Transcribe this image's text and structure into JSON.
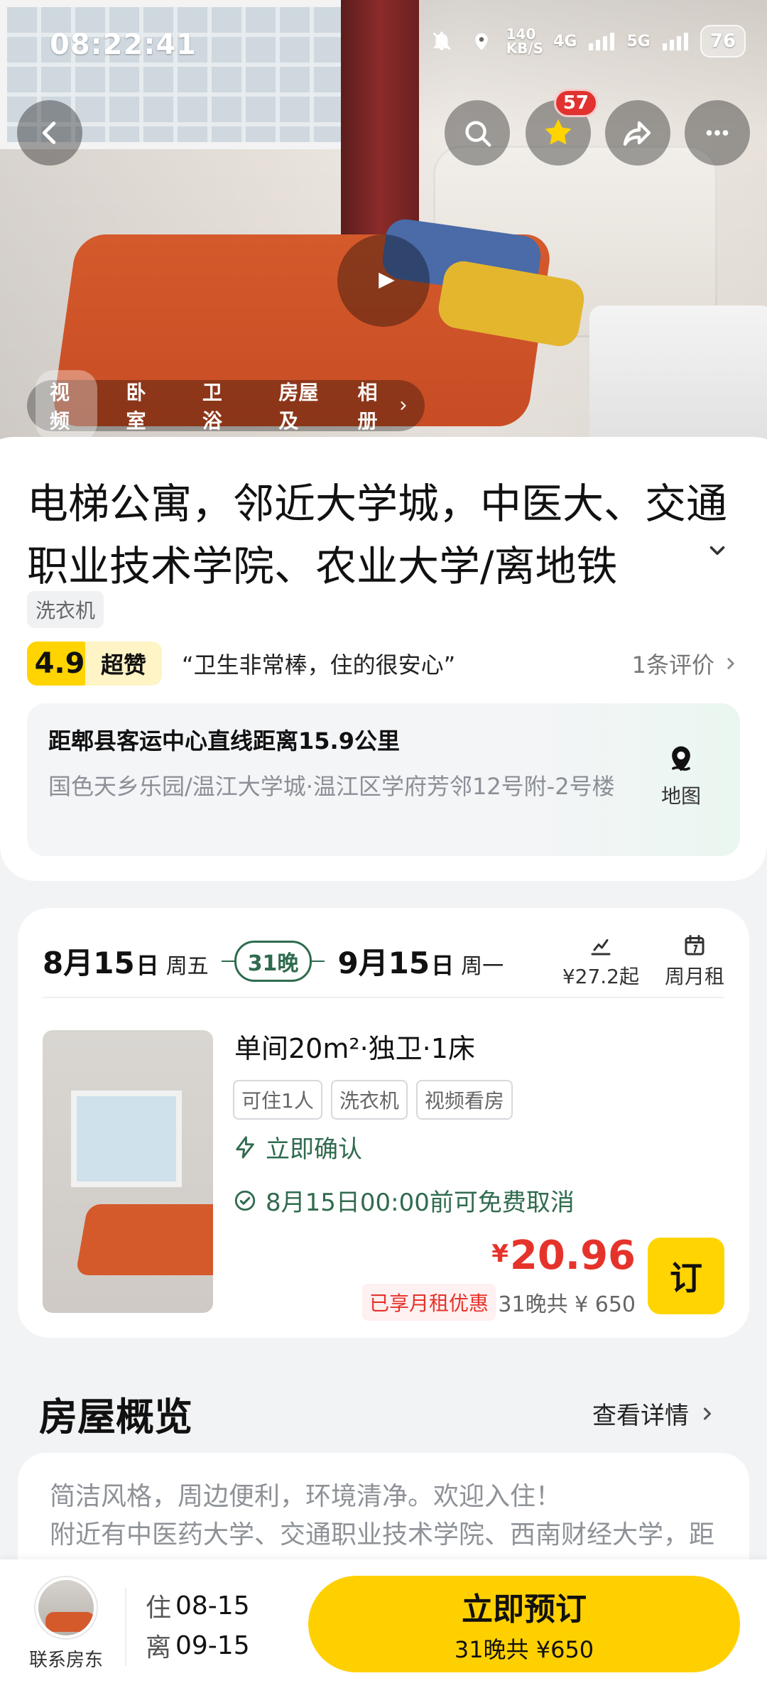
{
  "status_bar": {
    "time": "08:22:41",
    "net_speed": "140\nKB/S",
    "net_4g": "4G",
    "net_5g": "5G",
    "battery": "76"
  },
  "hero": {
    "badge_count": "57",
    "tabs": [
      "视频",
      "卧室",
      "卫浴",
      "房屋及"
    ],
    "album_label": "相册"
  },
  "listing": {
    "title": "电梯公寓，邻近大学城，中医大、交通职业技术学院、农业大学/离地铁",
    "amenity": "洗衣机",
    "rating_score": "4.9",
    "rating_label": "超赞",
    "rating_quote": "“卫生非常棒，住的很安心”",
    "reviews_label": "1条评价",
    "distance": "距郫县客运中心直线距离15.9公里",
    "address": "国色天乡乐园/温江大学城·温江区学府芳邻12号附-2号楼",
    "map_label": "地图"
  },
  "dates": {
    "check_in": "8月15",
    "check_in_day": "日",
    "check_in_weekday": "周五",
    "nights": "31晚",
    "check_out": "9月15",
    "check_out_day": "日",
    "check_out_weekday": "周一",
    "price_start": "¥27.2起",
    "monthly": "周月租"
  },
  "room": {
    "title": "单间20m²·独卫·1床",
    "tags": [
      "可住1人",
      "洗衣机",
      "视频看房"
    ],
    "instant_confirm": "立即确认",
    "free_cancel": "8月15日00:00前可免费取消",
    "price_currency": "¥",
    "price": "20.96",
    "discount": "已享月租优惠",
    "total": "31晚共 ¥ 650",
    "order_button": "订"
  },
  "overview": {
    "title": "房屋概览",
    "link": "查看详情",
    "text": "简洁风格，周边便利，环境清净。欢迎入住！\n附近有中医药大学、交通职业技术学院、西南财经大学，距"
  },
  "bottom": {
    "host_label": "联系房东",
    "in_label": "住",
    "in_date": "08-15",
    "out_label": "离",
    "out_date": "09-15",
    "book_label": "立即预订",
    "book_sub": "31晚共 ¥650"
  },
  "colors": {
    "accent_yellow": "#ffd400",
    "green": "#2f6b4e",
    "price_red": "#e5332b"
  }
}
